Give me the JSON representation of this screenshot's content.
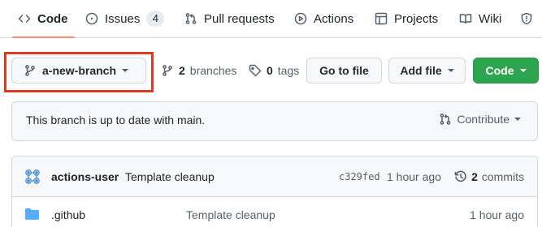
{
  "nav": {
    "tabs": [
      {
        "label": "Code",
        "icon": "code-icon",
        "active": true
      },
      {
        "label": "Issues",
        "icon": "issue-icon",
        "count": "4"
      },
      {
        "label": "Pull requests",
        "icon": "pull-request-icon"
      },
      {
        "label": "Actions",
        "icon": "play-icon"
      },
      {
        "label": "Projects",
        "icon": "table-icon"
      },
      {
        "label": "Wiki",
        "icon": "book-icon"
      },
      {
        "label": "",
        "icon": "shield-icon"
      }
    ]
  },
  "branch_bar": {
    "branch_name": "a-new-branch",
    "branches_count": "2",
    "branches_label": "branches",
    "tags_count": "0",
    "tags_label": "tags",
    "go_to_file": "Go to file",
    "add_file": "Add file",
    "code_button": "Code",
    "highlight_color": "#e03a1e",
    "primary_color": "#2da44e"
  },
  "banner": {
    "message": "This branch is up to date with main.",
    "contribute": "Contribute"
  },
  "latest_commit": {
    "author": "actions-user",
    "message": "Template cleanup",
    "sha": "c329fed",
    "time": "1 hour ago",
    "commits_count": "2",
    "commits_label": "commits"
  },
  "files": [
    {
      "name": ".github",
      "type": "folder",
      "message": "Template cleanup",
      "time": "1 hour ago"
    }
  ]
}
